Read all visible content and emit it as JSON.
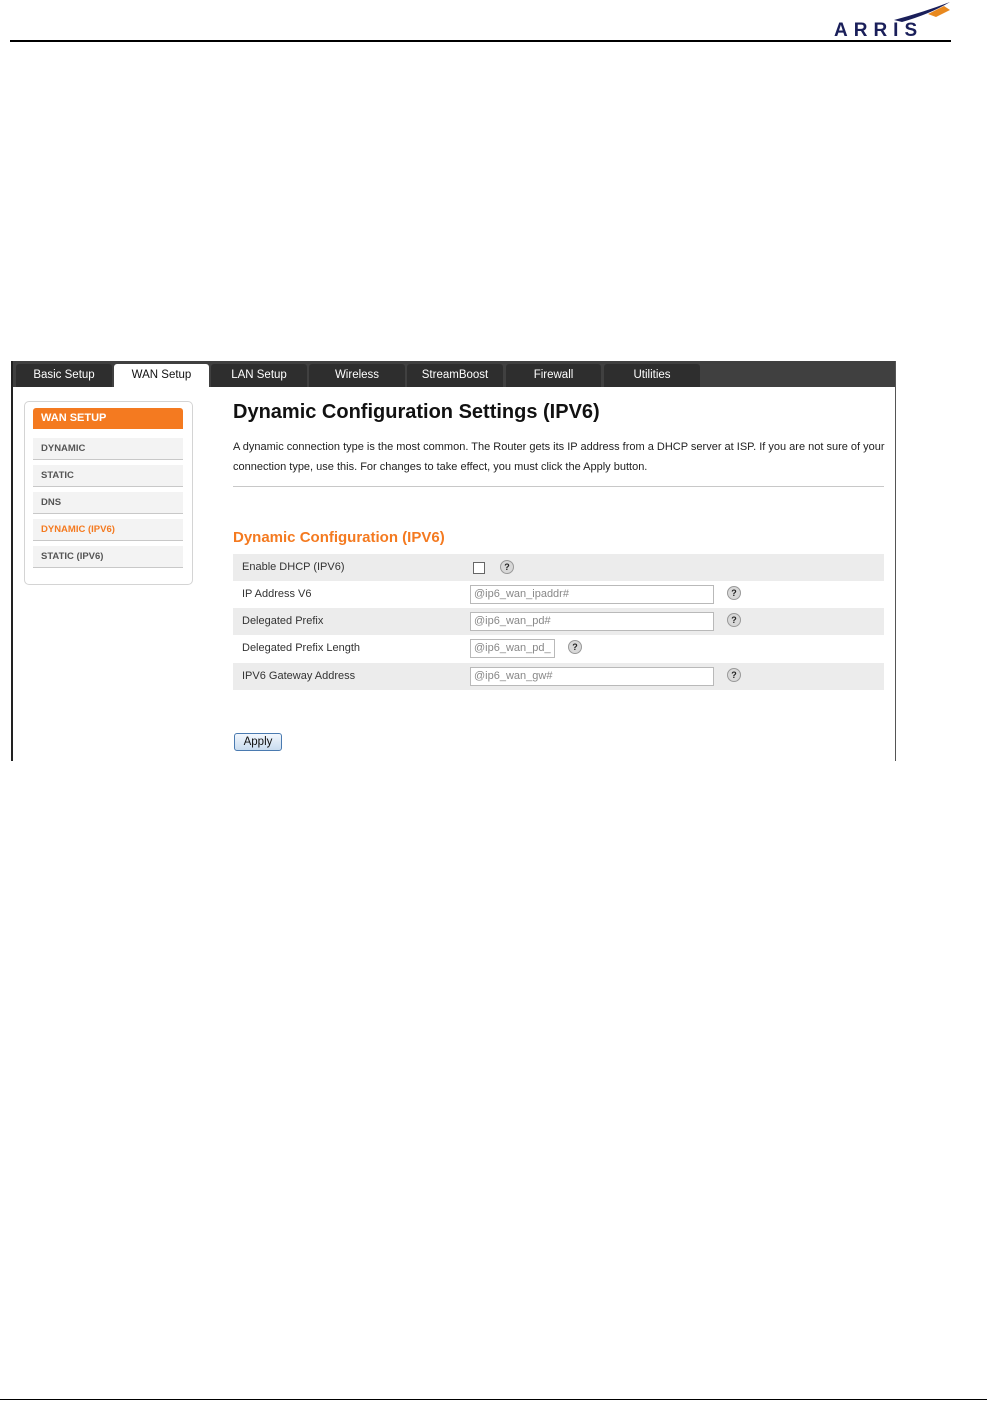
{
  "logo": {
    "text": "ARRIS"
  },
  "tabs": [
    {
      "label": "Basic Setup",
      "active": false
    },
    {
      "label": "WAN Setup",
      "active": true
    },
    {
      "label": "LAN Setup",
      "active": false
    },
    {
      "label": "Wireless",
      "active": false
    },
    {
      "label": "StreamBoost",
      "active": false
    },
    {
      "label": "Firewall",
      "active": false
    },
    {
      "label": "Utilities",
      "active": false
    }
  ],
  "sidebar": {
    "title": "WAN SETUP",
    "items": [
      {
        "label": "DYNAMIC",
        "active": false
      },
      {
        "label": "STATIC",
        "active": false
      },
      {
        "label": "DNS",
        "active": false
      },
      {
        "label": "DYNAMIC (IPV6)",
        "active": true
      },
      {
        "label": "STATIC (IPV6)",
        "active": false
      }
    ]
  },
  "main": {
    "title": "Dynamic Configuration Settings (IPV6)",
    "description": "A dynamic connection type is the most common. The Router gets its IP address from a DHCP server at ISP. If you are not sure of your connection type, use this. For changes to take effect, you must click the Apply button.",
    "section_title": "Dynamic Configuration (IPV6)",
    "rows": [
      {
        "label": "Enable DHCP (IPV6)",
        "type": "checkbox",
        "checked": false,
        "value": ""
      },
      {
        "label": "IP Address V6",
        "type": "text",
        "value": "@ip6_wan_ipaddr#"
      },
      {
        "label": "Delegated Prefix",
        "type": "text",
        "value": "@ip6_wan_pd#"
      },
      {
        "label": "Delegated Prefix Length",
        "type": "text",
        "value": "@ip6_wan_pd_"
      },
      {
        "label": "IPV6 Gateway Address",
        "type": "text",
        "value": "@ip6_wan_gw#"
      }
    ],
    "help_symbol": "?",
    "apply_label": "Apply"
  },
  "colors": {
    "accent": "#f47a20",
    "tabbar": "#404040",
    "tab": "#2e2e2e",
    "logo": "#1a1f5a"
  }
}
